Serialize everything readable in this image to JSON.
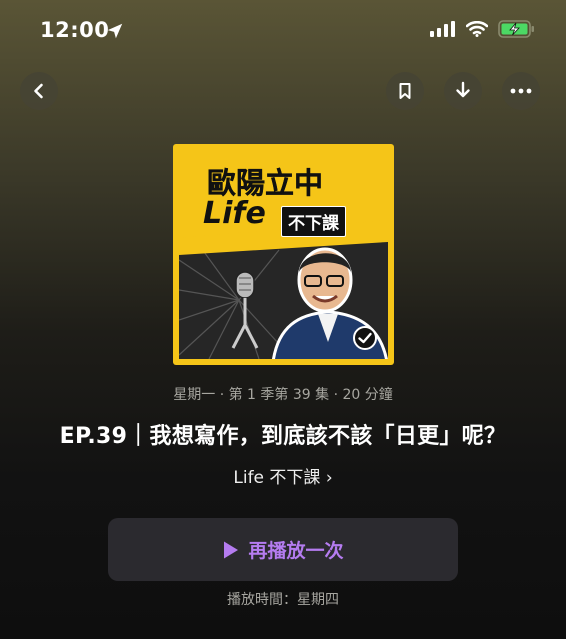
{
  "status_bar": {
    "time": "12:00"
  },
  "header": {
    "back_icon": "chevron-left-icon",
    "bookmark_icon": "bookmark-icon",
    "download_icon": "download-icon",
    "more_icon": "more-icon"
  },
  "cover": {
    "title": "歐陽立中",
    "life": "Life",
    "subtitle": "不下課"
  },
  "episode": {
    "meta": "星期一 · 第 1 季第 39 集 · 20 分鐘",
    "title": "EP.39｜我想寫作，到底該不該「日更」呢？",
    "show_name": "Life 不下課 ›"
  },
  "replay_button": {
    "label": "再播放一次",
    "accent": "#b57cf0"
  },
  "schedule": {
    "text": "播放時間：星期四"
  }
}
